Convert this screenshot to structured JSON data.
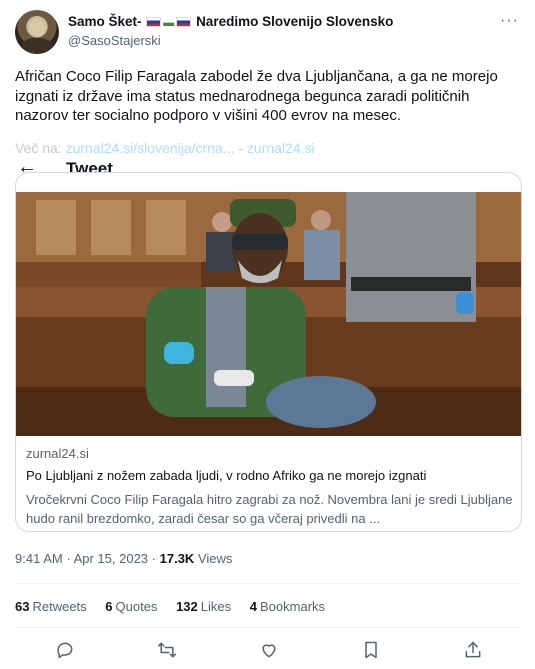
{
  "author": {
    "name_prefix": "Samo Šket-",
    "name_suffix": "Naredimo Slovenijo Slovensko",
    "handle": "@SasoStajerski"
  },
  "tweet": {
    "text": "Afričan Coco Filip Faragala zabodel že dva Ljubljančana, a ga ne morejo izgnati iz države ima status mednarodnega begunca zaradi političnih nazorov ter socialno podporo v višini 400 evrov na mesec.",
    "link_prefix": "Več na:",
    "link_1": "zurnal24.si/slovenija/crna...",
    "link_sep": "-",
    "link_2": "zurnal24.si"
  },
  "overlay": {
    "title": "Tweet"
  },
  "card": {
    "domain": "zurnal24.si",
    "title": "Po Ljubljani z nožem zabada ljudi, v rodno Afriko ga ne morejo izgnati",
    "description": "Vročekrvni Coco Filip Faragala hitro zagrabi za nož. Novembra lani je sredi Ljubljane hudo ranil brezdomko, zaradi česar so ga včeraj privedli na ..."
  },
  "meta": {
    "time": "9:41 AM",
    "dot": "·",
    "date": "Apr 15, 2023",
    "views_count": "17.3K",
    "views_label": "Views"
  },
  "stats": {
    "retweets_count": "63",
    "retweets_label": "Retweets",
    "quotes_count": "6",
    "quotes_label": "Quotes",
    "likes_count": "132",
    "likes_label": "Likes",
    "bookmarks_count": "4",
    "bookmarks_label": "Bookmarks"
  },
  "icons": {
    "more": "more-icon",
    "back": "back-arrow-icon",
    "reply": "reply-icon",
    "retweet": "retweet-icon",
    "like": "like-icon",
    "bookmark": "bookmark-icon",
    "share": "share-icon"
  },
  "colors": {
    "link": "#1d9bf0",
    "secondary_text": "#536471",
    "primary_text": "#0f1419",
    "border": "#cfd9de"
  }
}
